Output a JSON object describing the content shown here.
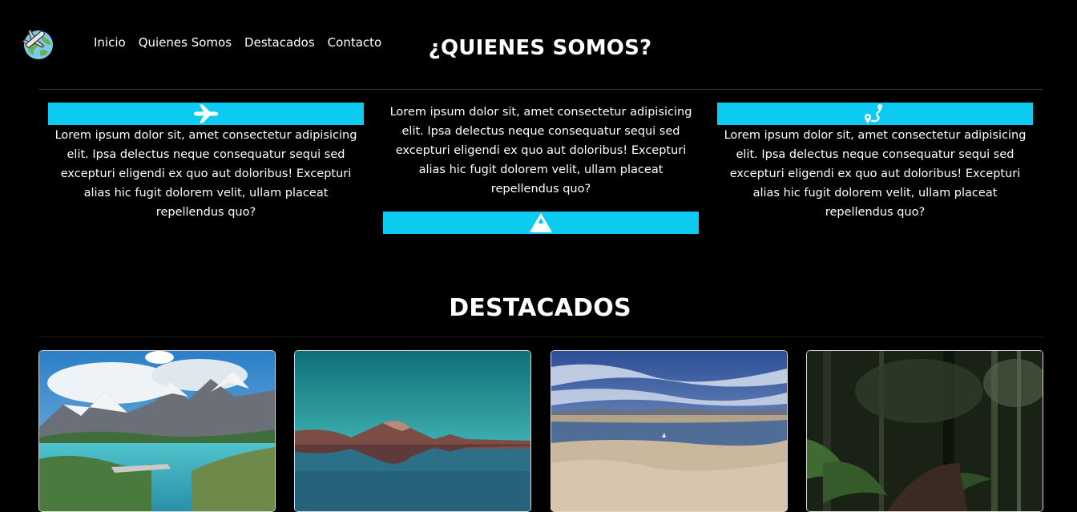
{
  "nav": {
    "items": [
      "Inicio",
      "Quienes Somos",
      "Destacados",
      "Contacto"
    ]
  },
  "about": {
    "title": "¿QUIENES SOMOS?",
    "columns": [
      {
        "icon": "airplane-icon",
        "text": "Lorem ipsum dolor sit, amet consectetur adipisicing elit. Ipsa delectus neque consequatur sequi sed excepturi eligendi ex quo aut doloribus! Excepturi alias hic fugit dolorem velit, ullam placeat repellendus quo?"
      },
      {
        "icon": "mountain-icon",
        "text": "Lorem ipsum dolor sit, amet consectetur adipisicing elit. Ipsa delectus neque consequatur sequi sed excepturi eligendi ex quo aut doloribus! Excepturi alias hic fugit dolorem velit, ullam placeat repellendus quo?"
      },
      {
        "icon": "route-icon",
        "text": "Lorem ipsum dolor sit, amet consectetur adipisicing elit. Ipsa delectus neque consequatur sequi sed excepturi eligendi ex quo aut doloribus! Excepturi alias hic fugit dolorem velit, ullam placeat repellendus quo?"
      }
    ]
  },
  "featured": {
    "title": "DESTACADOS",
    "cards": [
      {
        "image": "patagonia-lake-mountains"
      },
      {
        "image": "volcano-reflection-teal-sky"
      },
      {
        "image": "salt-flat-lagoon-clouds"
      },
      {
        "image": "dark-fern-forest"
      }
    ]
  },
  "colors": {
    "background": "#000000",
    "accent": "#0dcaf0",
    "text": "#ffffff"
  }
}
